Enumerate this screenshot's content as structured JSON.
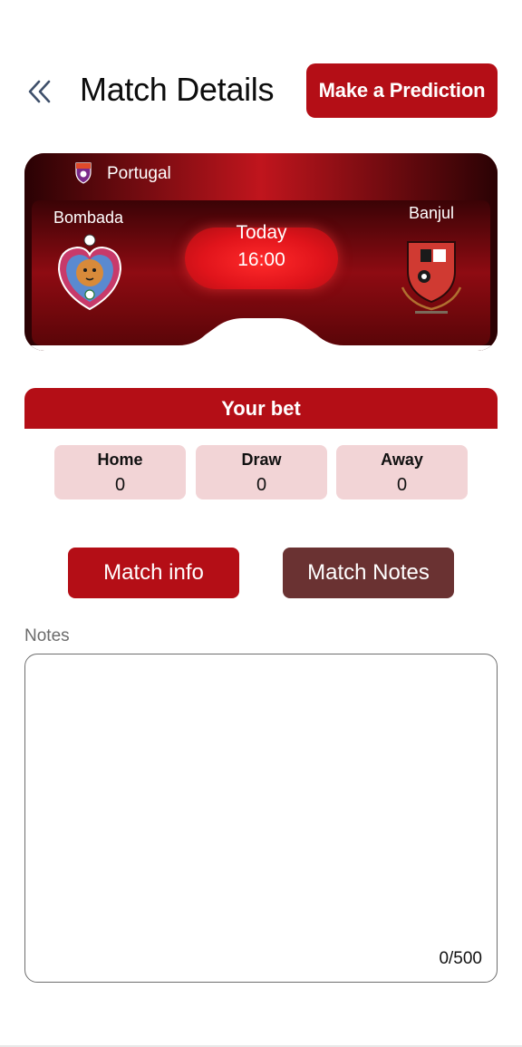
{
  "header": {
    "title": "Match Details",
    "back_icon": "double-chevron-left-icon",
    "predict_label": "Make a Prediction"
  },
  "match": {
    "league": "Portugal",
    "home_team": "Bombada",
    "away_team": "Banjul",
    "day": "Today",
    "time": "16:00",
    "home_logo_icon": "tiger-crest-icon",
    "away_logo_icon": "red-shield-crest-icon",
    "league_logo_icon": "league-shield-icon"
  },
  "bet": {
    "title": "Your bet",
    "home_label": "Home",
    "home_value": "0",
    "draw_label": "Draw",
    "draw_value": "0",
    "away_label": "Away",
    "away_value": "0"
  },
  "tabs": {
    "info_label": "Match info",
    "notes_label": "Match Notes"
  },
  "notes": {
    "label": "Notes",
    "value": "",
    "counter": "0/500"
  },
  "colors": {
    "accent": "#b40e16",
    "accent_dark": "#6a3232",
    "bet_box": "#f2d4d6"
  }
}
